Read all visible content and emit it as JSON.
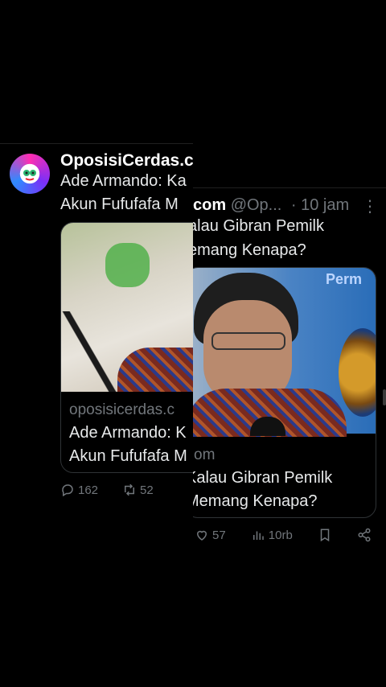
{
  "left_post": {
    "name": "OposisiCerdas.c",
    "text_line1": "Ade Armando: Ka",
    "text_line2": "Akun Fufufafa M",
    "card": {
      "domain": "oposisicerdas.c",
      "title_line1": "Ade Armando: K",
      "title_line2": "Akun Fufufafa M"
    },
    "actions": {
      "replies": "162",
      "reposts": "52"
    }
  },
  "right_post": {
    "name_fragment": "com",
    "handle": "@Op...",
    "time": "· 10 jam",
    "more": "⋮",
    "text_line1": "alau Gibran Pemilk",
    "text_line2": "emang Kenapa?",
    "card": {
      "domain": "om",
      "title_line1": "Kalau Gibran Pemilk",
      "title_line2": "Memang Kenapa?",
      "image_logo": "Perm"
    },
    "actions": {
      "likes": "57",
      "views": "10rb"
    }
  }
}
